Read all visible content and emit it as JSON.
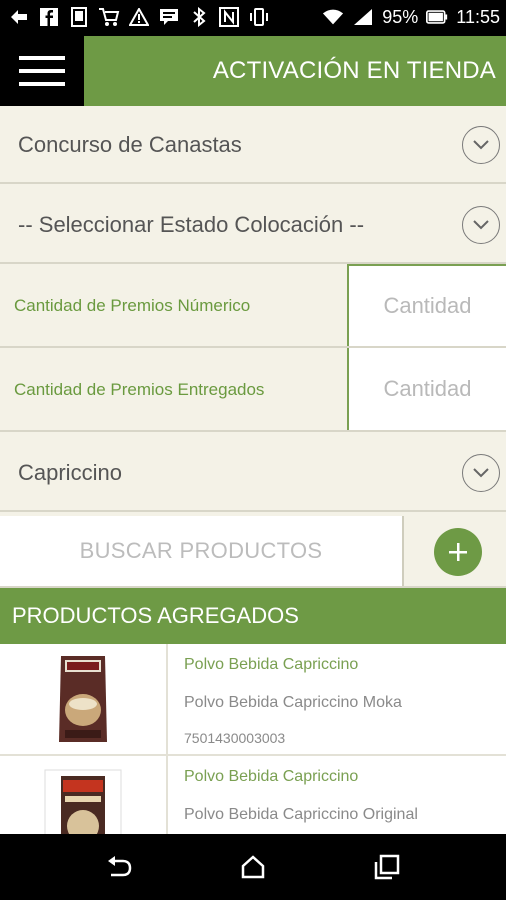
{
  "status_bar": {
    "battery": "95%",
    "time": "11:55",
    "icons": [
      "back-arrow-icon",
      "facebook-icon",
      "phone-icon",
      "cart-icon",
      "warning-icon",
      "chat-icon",
      "bluetooth-icon",
      "nfc-icon",
      "vibrate-icon",
      "wifi-icon",
      "signal-icon",
      "battery-icon"
    ]
  },
  "app_bar": {
    "title": "ACTIVACIÓN EN TIENDA",
    "menu_icon": "hamburger-icon"
  },
  "form": {
    "contest_select": "Concurso de Canastas",
    "placement_state_select": "-- Seleccionar Estado Colocación --",
    "prizes_number_label": "Cantidad de Premios Númerico",
    "prizes_number_placeholder": "Cantidad",
    "prizes_delivered_label": "Cantidad  de Premios Entregados",
    "prizes_delivered_placeholder": "Cantidad",
    "brand_select": "Capriccino",
    "search_placeholder": "BUSCAR PRODUCTOS"
  },
  "products_section": {
    "header": "PRODUCTOS AGREGADOS",
    "items": [
      {
        "name": "Polvo Bebida Capriccino",
        "description": "Polvo Bebida Capriccino Moka",
        "code": "7501430003003"
      },
      {
        "name": "Polvo Bebida Capriccino",
        "description": "Polvo Bebida Capriccino Original",
        "code": ""
      }
    ]
  },
  "colors": {
    "accent": "#6e9a45",
    "background": "#f4f2e7",
    "label_green": "#6a9a3f"
  }
}
